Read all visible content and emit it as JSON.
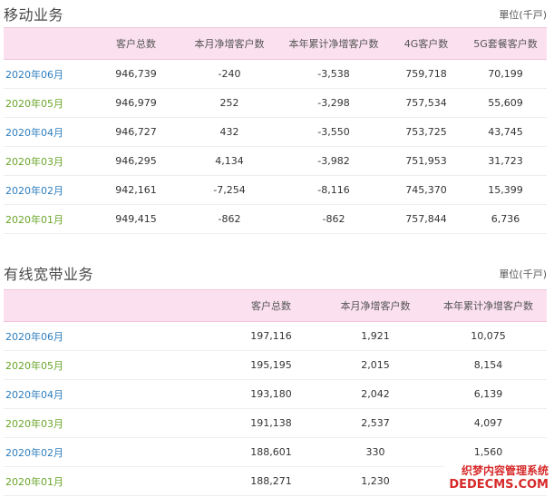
{
  "mobile": {
    "title": "移动业务",
    "unit": "單位(千戸)",
    "headers": [
      "",
      "客户总数",
      "本月净增客户数",
      "本年累计净增客户数",
      "4G客户数",
      "5G套餐客户数"
    ],
    "rows": [
      {
        "month": "2020年06月",
        "total": "946,739",
        "month_net": "-240",
        "ytd_net": "-3,538",
        "g4": "759,718",
        "g5": "70,199"
      },
      {
        "month": "2020年05月",
        "total": "946,979",
        "month_net": "252",
        "ytd_net": "-3,298",
        "g4": "757,534",
        "g5": "55,609"
      },
      {
        "month": "2020年04月",
        "total": "946,727",
        "month_net": "432",
        "ytd_net": "-3,550",
        "g4": "753,725",
        "g5": "43,745"
      },
      {
        "month": "2020年03月",
        "total": "946,295",
        "month_net": "4,134",
        "ytd_net": "-3,982",
        "g4": "751,953",
        "g5": "31,723"
      },
      {
        "month": "2020年02月",
        "total": "942,161",
        "month_net": "-7,254",
        "ytd_net": "-8,116",
        "g4": "745,370",
        "g5": "15,399"
      },
      {
        "month": "2020年01月",
        "total": "949,415",
        "month_net": "-862",
        "ytd_net": "-862",
        "g4": "757,844",
        "g5": "6,736"
      }
    ]
  },
  "broadband": {
    "title": "有线宽带业务",
    "unit": "單位(千戸)",
    "headers": [
      "",
      "客户总数",
      "本月净增客户数",
      "本年累计净增客户数"
    ],
    "rows": [
      {
        "month": "2020年06月",
        "total": "197,116",
        "month_net": "1,921",
        "ytd_net": "10,075"
      },
      {
        "month": "2020年05月",
        "total": "195,195",
        "month_net": "2,015",
        "ytd_net": "8,154"
      },
      {
        "month": "2020年04月",
        "total": "193,180",
        "month_net": "2,042",
        "ytd_net": "6,139"
      },
      {
        "month": "2020年03月",
        "total": "191,138",
        "month_net": "2,537",
        "ytd_net": "4,097"
      },
      {
        "month": "2020年02月",
        "total": "188,601",
        "month_net": "330",
        "ytd_net": "1,560"
      },
      {
        "month": "2020年01月",
        "total": "188,271",
        "month_net": "1,230",
        "ytd_net": ""
      }
    ]
  },
  "watermark": {
    "line1": "织梦内容管理系统",
    "line2": "DEDECMS.COM"
  },
  "colors": {
    "header_bg": "#fbe0ef",
    "month_blue": "#2e7ebd",
    "month_green": "#6aa52a"
  }
}
